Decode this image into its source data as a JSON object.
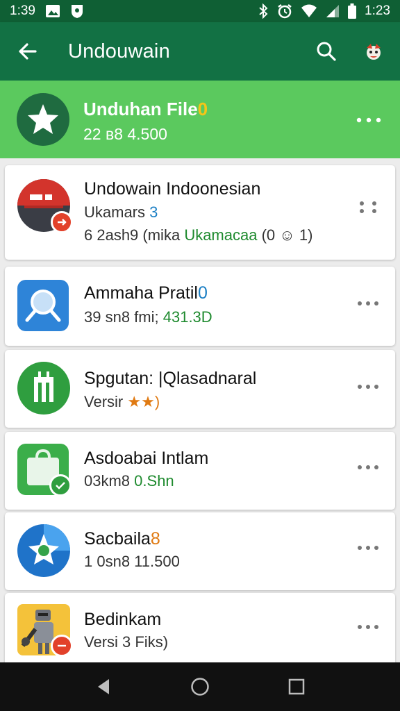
{
  "status_bar": {
    "time_left": "1:39",
    "time_right": "1:23"
  },
  "app_bar": {
    "title": "Undouwain"
  },
  "banner": {
    "title": "Unduhan File",
    "title_accent": "0",
    "subtitle": "22 в8 4.500"
  },
  "items": [
    {
      "title": "Undowain Indoonesian",
      "line1": "Ukamars",
      "line1_accent": "3",
      "line2": "6 2ash9 (mika",
      "line2_accent": "Ukamacaa",
      "line2_tail": "(0 ☺ 1)",
      "icon": "red-bus-icon"
    },
    {
      "title": "Ammaha Pratil",
      "title_accent": "0",
      "line1": "39 sn8 fmi;",
      "line1_accent": "431.3D",
      "icon": "blue-magnifier-icon"
    },
    {
      "title": "Spgutan: |Qlasadnaral",
      "line1": "Versir",
      "line1_accent": "★★)",
      "icon": "green-tool-icon"
    },
    {
      "title": "Asdoabai Intlam",
      "line1": "03km8",
      "line1_accent": "0.Shn",
      "icon": "green-bag-icon"
    },
    {
      "title": "Sacbaila",
      "title_accent": "8",
      "line1": "1 0sn8 11.500",
      "icon": "blue-star-icon"
    },
    {
      "title": "Bedinkam",
      "line1": "Versi 3 Fiks)",
      "icon": "robot-game-icon"
    }
  ],
  "colors": {
    "status_bar": "#0f5f34",
    "app_bar": "#127144",
    "banner": "#5bc95e",
    "accent_green": "#1e8a2e",
    "accent_blue": "#1b7fc4",
    "accent_orange": "#e07a12"
  }
}
